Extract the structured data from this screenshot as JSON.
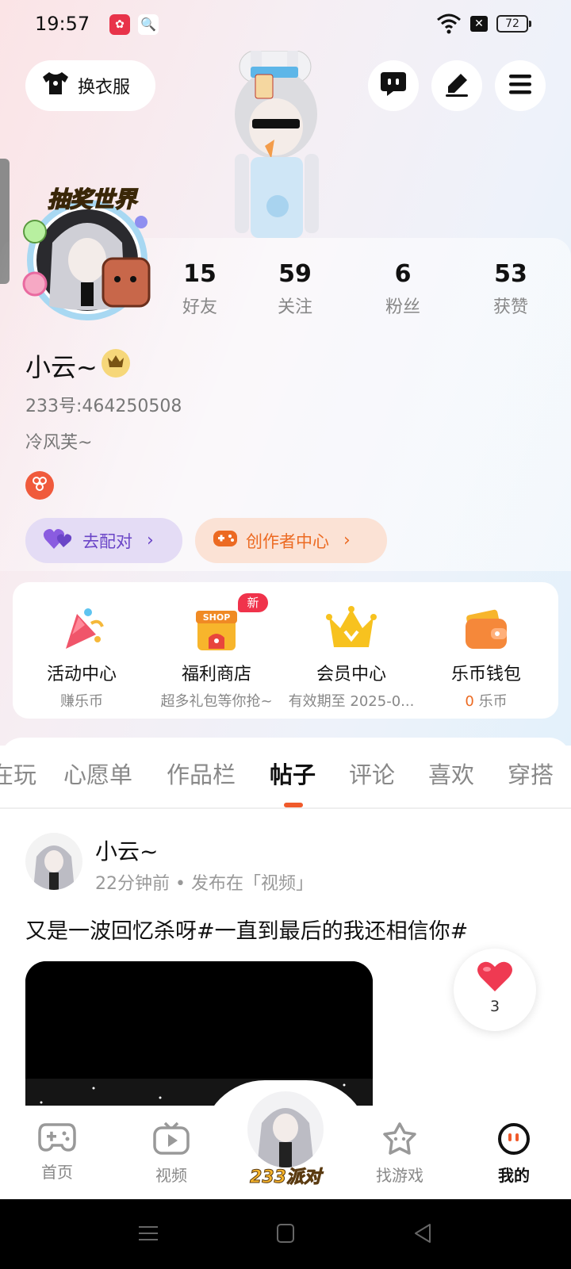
{
  "status_bar": {
    "time": "19:57",
    "battery": "72"
  },
  "header": {
    "outfit_label": "换衣服"
  },
  "stats": [
    {
      "value": "15",
      "label": "好友"
    },
    {
      "value": "59",
      "label": "关注"
    },
    {
      "value": "6",
      "label": "粉丝"
    },
    {
      "value": "53",
      "label": "获赞"
    }
  ],
  "profile": {
    "name": "小云~",
    "uid": "233号:464250508",
    "bio": "冷风芙~",
    "avatar_frame_text": "抽奖世界"
  },
  "actions": {
    "pair_label": "去配对",
    "creator_label": "创作者中心"
  },
  "services": [
    {
      "title": "活动中心",
      "sub": "赚乐币"
    },
    {
      "title": "福利商店",
      "sub": "超多礼包等你抢~",
      "tag": "新"
    },
    {
      "title": "会员中心",
      "sub": "有效期至 2025-0..."
    },
    {
      "title": "乐币钱包",
      "sub_value": "0",
      "sub_unit": " 乐币"
    }
  ],
  "tabs": [
    "在玩",
    "心愿单",
    "作品栏",
    "帖子",
    "评论",
    "喜欢",
    "穿搭"
  ],
  "active_tab": "帖子",
  "post": {
    "author": "小云~",
    "meta": "22分钟前 • 发布在「视频」",
    "text": "又是一波回忆杀呀#一直到最后的我还相信你#",
    "likes": "3"
  },
  "bottom_nav": [
    {
      "label": "首页"
    },
    {
      "label": "视频"
    },
    {
      "label": "233派对"
    },
    {
      "label": "找游戏"
    },
    {
      "label": "我的"
    }
  ],
  "colors": {
    "accent": "#f05a2b",
    "pair": "#6a45c7",
    "creator": "#ec6a22"
  }
}
